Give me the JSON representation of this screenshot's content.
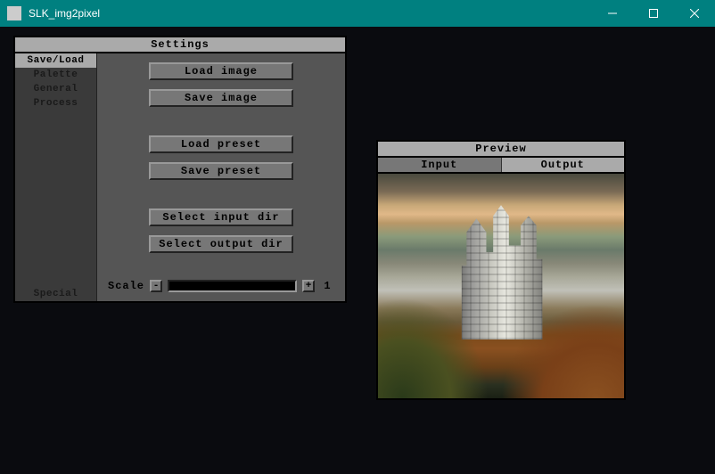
{
  "window": {
    "title": "SLK_img2pixel"
  },
  "settings": {
    "title": "Settings",
    "sidebar": {
      "items": [
        {
          "label": "Save/Load",
          "active": true
        },
        {
          "label": "Palette",
          "active": false
        },
        {
          "label": "General",
          "active": false
        },
        {
          "label": "Process",
          "active": false
        }
      ],
      "bottom_item": {
        "label": "Special"
      }
    },
    "buttons": {
      "load_image": "Load image",
      "save_image": "Save image",
      "load_preset": "Load preset",
      "save_preset": "Save preset",
      "select_input_dir": "Select input dir",
      "select_output_dir": "Select output dir"
    },
    "scale": {
      "label": "Scale",
      "dec": "-",
      "inc": "+",
      "value": "1"
    }
  },
  "preview": {
    "title": "Preview",
    "tabs": {
      "input": "Input",
      "output": "Output"
    }
  }
}
